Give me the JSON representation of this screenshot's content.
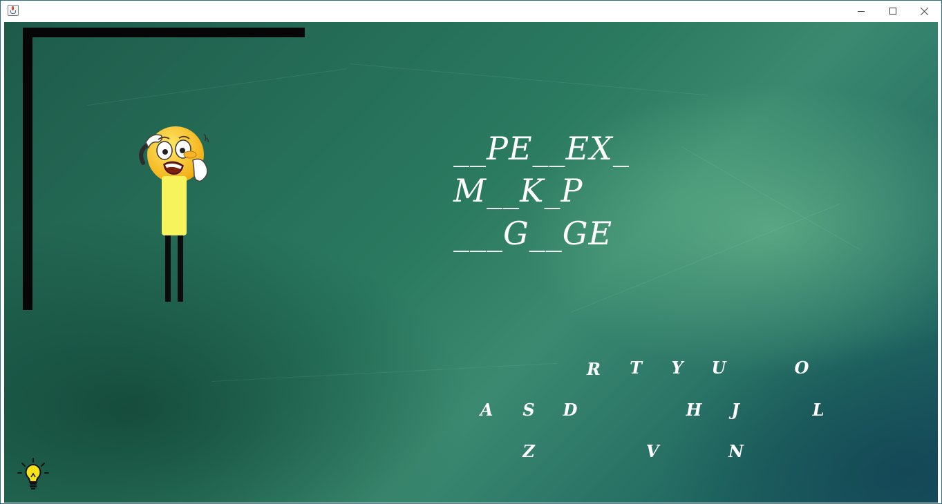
{
  "window": {
    "controls": [
      "minimize",
      "maximize",
      "close"
    ]
  },
  "game": {
    "words": [
      "__PE__EX_",
      "M__K_P",
      "___G__GE"
    ],
    "keyboard": {
      "row1": [
        "R",
        "T",
        "Y",
        "U",
        "O"
      ],
      "row2": [
        "A",
        "S",
        "D",
        "H",
        "J",
        "L"
      ],
      "row3": [
        "Z",
        "V",
        "N"
      ]
    },
    "figure_parts_shown": [
      "head",
      "torso",
      "left-leg",
      "right-leg"
    ],
    "hint_icon": "lightbulb-icon",
    "colors": {
      "board": "#2a7a60",
      "chalk": "#ffffff",
      "gallows": "#060606",
      "torso": "#f7f35d",
      "face": "#f8c51e"
    }
  }
}
